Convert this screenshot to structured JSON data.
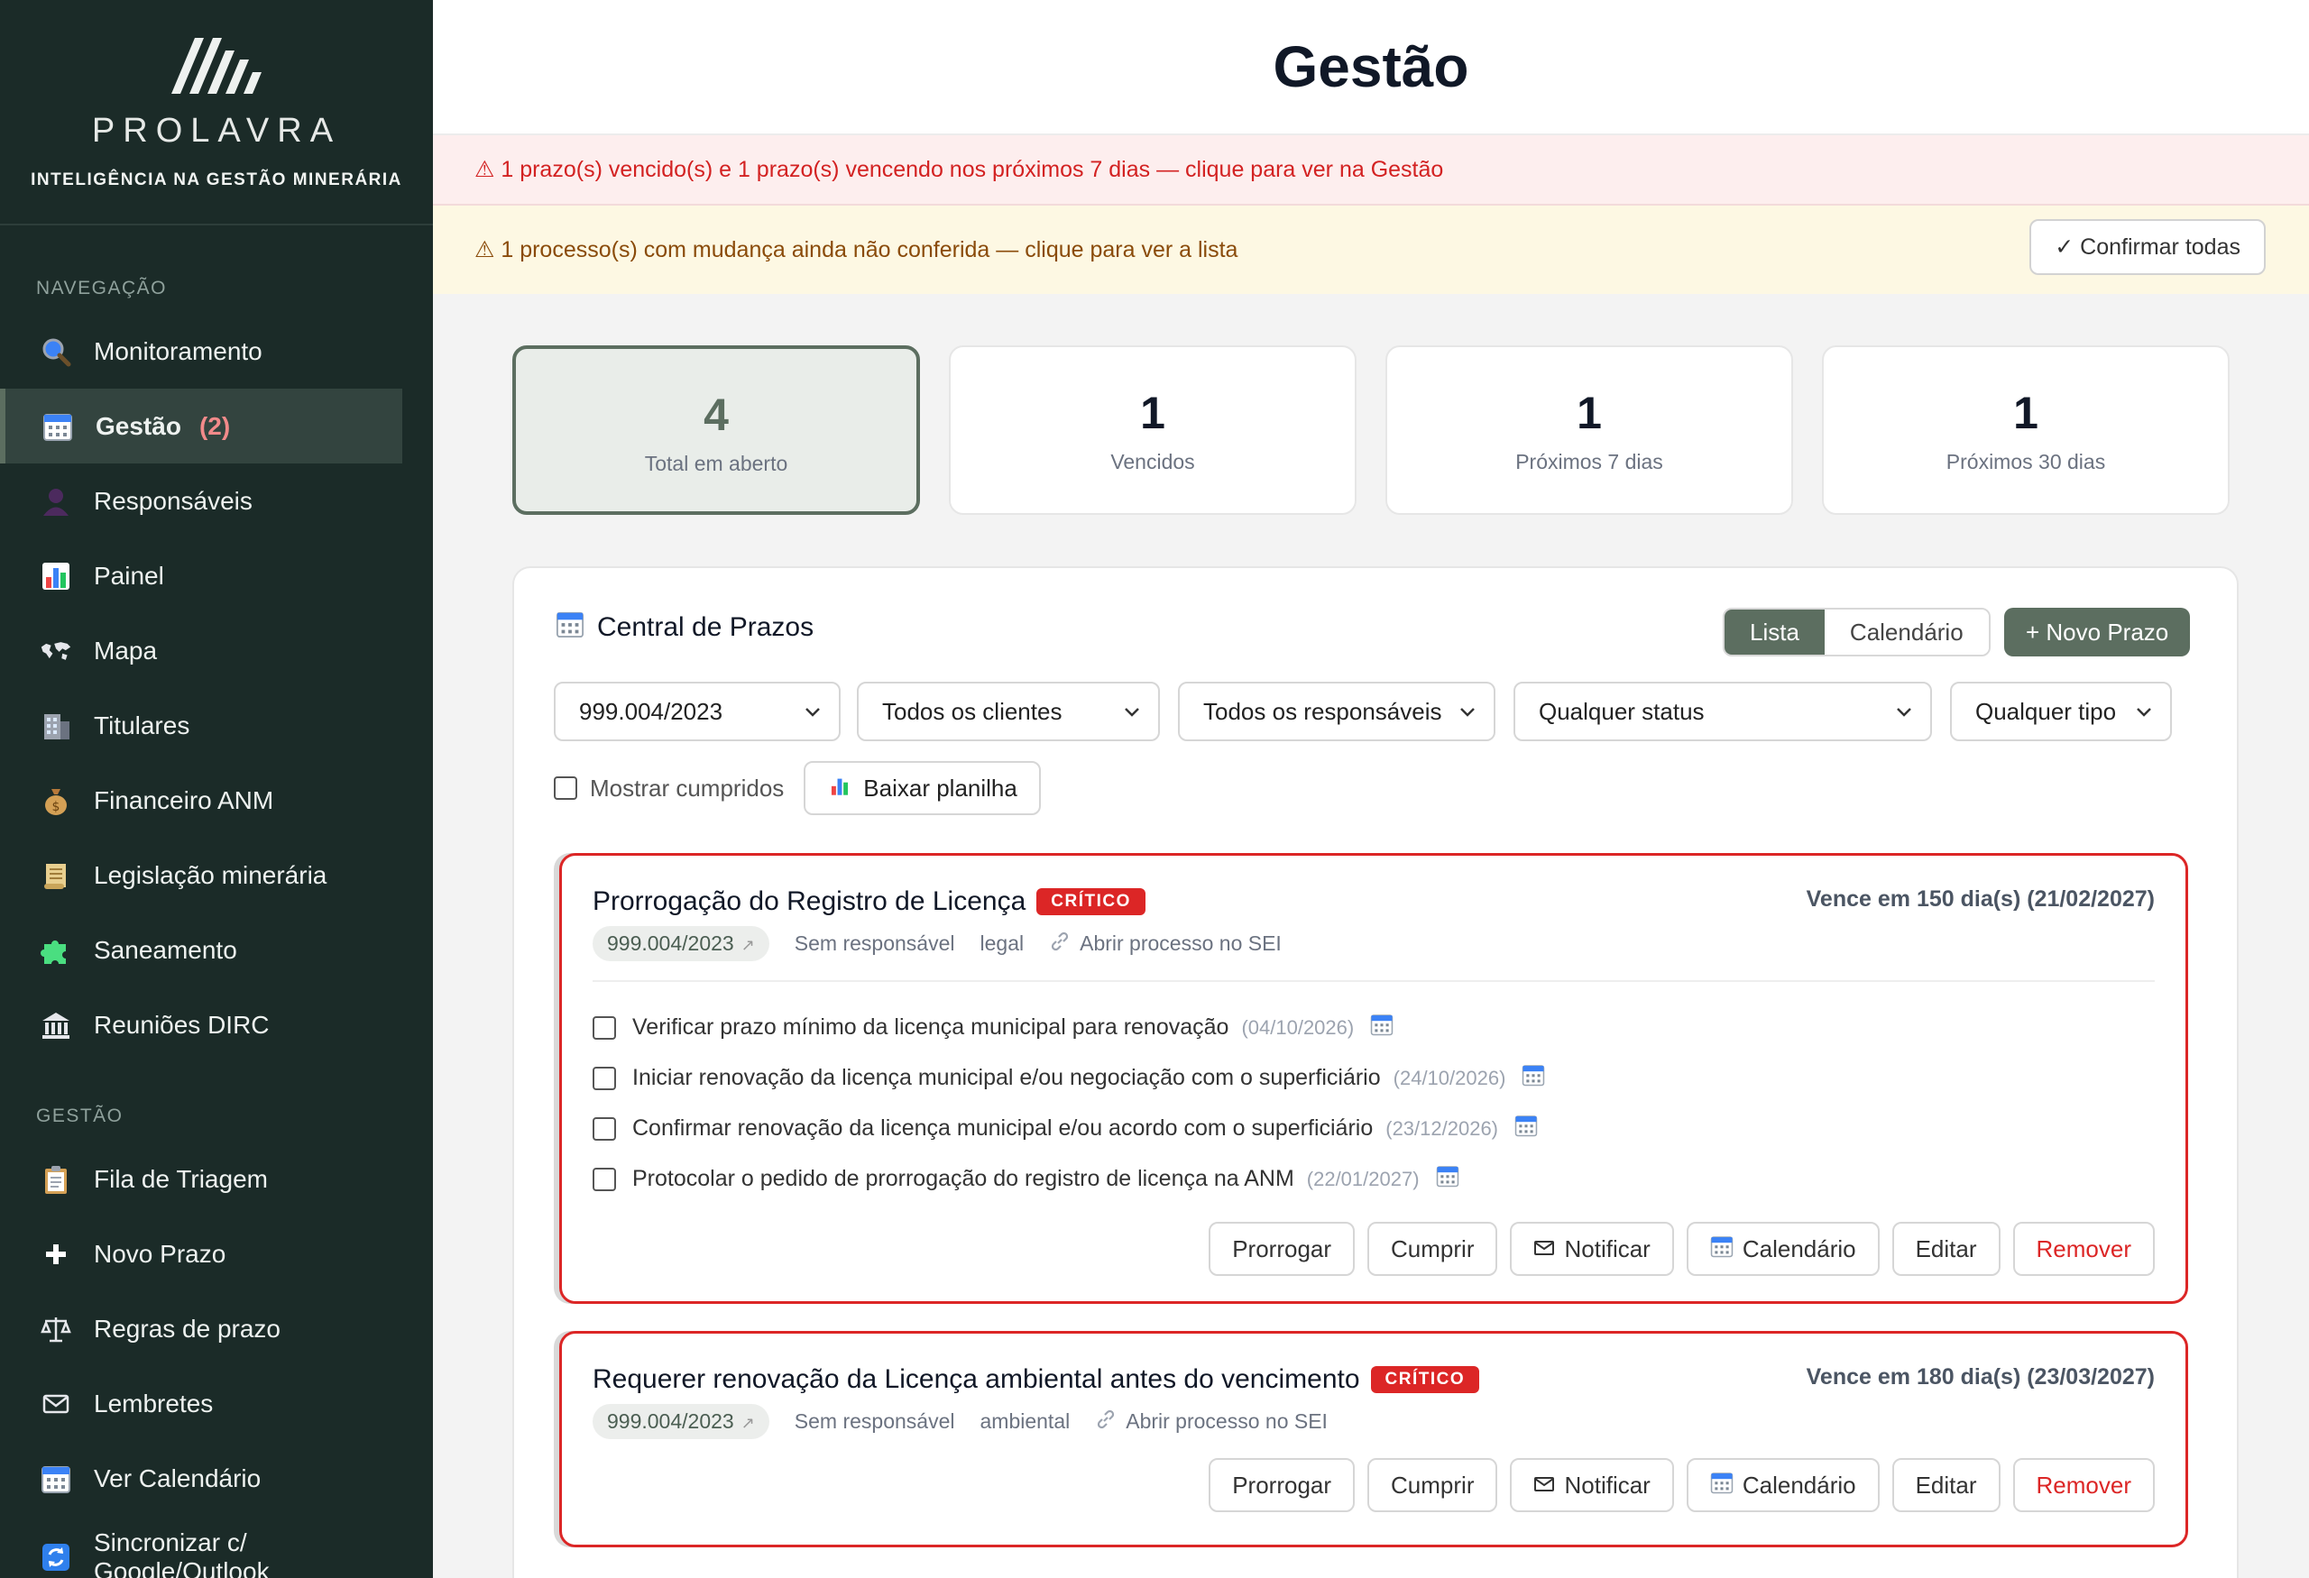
{
  "brand": {
    "name": "PROLAVRA",
    "tagline": "INTELIGÊNCIA NA GESTÃO MINERÁRIA"
  },
  "sidebar": {
    "section_nav": "NAVEGAÇÃO",
    "section_gestao": "GESTÃO",
    "nav_items": [
      {
        "label": "Monitoramento",
        "icon": "magnifier-icon"
      },
      {
        "label": "Gestão",
        "icon": "calendar-icon",
        "count": "(2)",
        "active": true
      },
      {
        "label": "Responsáveis",
        "icon": "person-icon"
      },
      {
        "label": "Painel",
        "icon": "bar-chart-icon"
      },
      {
        "label": "Mapa",
        "icon": "world-map-icon"
      },
      {
        "label": "Titulares",
        "icon": "building-icon"
      },
      {
        "label": "Financeiro ANM",
        "icon": "money-bag-icon"
      },
      {
        "label": "Legislação minerária",
        "icon": "scroll-icon"
      },
      {
        "label": "Saneamento",
        "icon": "puzzle-icon"
      },
      {
        "label": "Reuniões DIRC",
        "icon": "bank-icon"
      }
    ],
    "gestao_items": [
      {
        "label": "Fila de Triagem",
        "icon": "clipboard-icon"
      },
      {
        "label": "Novo Prazo",
        "icon": "plus-icon"
      },
      {
        "label": "Regras de prazo",
        "icon": "scales-icon"
      },
      {
        "label": "Lembretes",
        "icon": "envelope-icon"
      },
      {
        "label": "Ver Calendário",
        "icon": "calendar-icon"
      },
      {
        "label_line1": "Sincronizar c/",
        "label_line2": "Google/Outlook",
        "icon": "sync-icon"
      }
    ]
  },
  "header": {
    "title": "Gestão"
  },
  "alerts": {
    "red": "⚠ 1 prazo(s) vencido(s) e 1 prazo(s) vencendo nos próximos 7 dias — clique para ver na Gestão",
    "yellow": "⚠ 1 processo(s) com mudança ainda não conferida — clique para ver a lista",
    "confirm_all": "✓ Confirmar todas"
  },
  "stats": [
    {
      "value": "4",
      "label": "Total em aberto"
    },
    {
      "value": "1",
      "label": "Vencidos"
    },
    {
      "value": "1",
      "label": "Próximos 7 dias"
    },
    {
      "value": "1",
      "label": "Próximos 30 dias"
    }
  ],
  "central": {
    "title": "Central de Prazos",
    "view_list": "Lista",
    "view_calendar": "Calendário",
    "new_deadline": "+ Novo Prazo",
    "filters": {
      "process": "999.004/2023",
      "clients": "Todos os clientes",
      "responsibles": "Todos os responsáveis",
      "status": "Qualquer status",
      "type": "Qualquer tipo"
    },
    "show_done": "Mostrar cumpridos",
    "download": "Baixar planilha"
  },
  "actions": {
    "extend": "Prorrogar",
    "fulfill": "Cumprir",
    "notify": "Notificar",
    "calendar": "Calendário",
    "edit": "Editar",
    "remove": "Remover"
  },
  "tasks": [
    {
      "title": "Prorrogação do Registro de Licença",
      "badge": "CRÍTICO",
      "due": "Vence em 150 dia(s) (21/02/2027)",
      "process": "999.004/2023",
      "responsible": "Sem responsável",
      "category": "legal",
      "sei_link": "Abrir processo no SEI",
      "subtasks": [
        {
          "text": "Verificar prazo mínimo da licença municipal para renovação",
          "date": "(04/10/2026)"
        },
        {
          "text": "Iniciar renovação da licença municipal e/ou negociação com o superficiário",
          "date": "(24/10/2026)"
        },
        {
          "text": "Confirmar renovação da licença municipal e/ou acordo com o superficiário",
          "date": "(23/12/2026)"
        },
        {
          "text": "Protocolar o pedido de prorrogação do registro de licença na ANM",
          "date": "(22/01/2027)"
        }
      ]
    },
    {
      "title": "Requerer renovação da Licença ambiental antes do vencimento",
      "badge": "CRÍTICO",
      "due": "Vence em 180 dia(s) (23/03/2027)",
      "process": "999.004/2023",
      "responsible": "Sem responsável",
      "category": "ambiental",
      "sei_link": "Abrir processo no SEI"
    }
  ]
}
